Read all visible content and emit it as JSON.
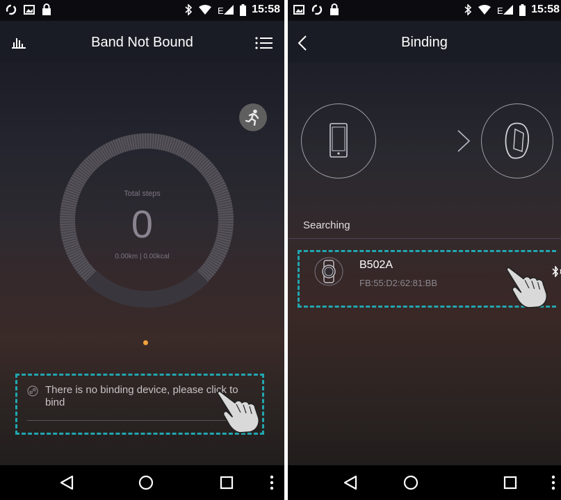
{
  "status_bar": {
    "time": "15:58"
  },
  "screen1": {
    "title": "Band Not Bound",
    "total_steps_label": "Total steps",
    "steps_value": "0",
    "distance_calories": "0.00km | 0.00kcal",
    "bind_prompt": "There is no binding device, please click to bind"
  },
  "screen2": {
    "title": "Binding",
    "searching_label": "Searching",
    "device": {
      "name": "B502A",
      "mac": "FB:55:D2:62:81:BB"
    }
  },
  "colors": {
    "highlight_dash": "#22a6b0",
    "page_dot": "#f0a23a"
  },
  "icons": [
    "chart-icon",
    "menu-icon",
    "running-icon",
    "link-icon",
    "back-icon",
    "phone-icon",
    "band-icon",
    "bluetooth-icon",
    "watch-icon",
    "pointing-hand-icon"
  ]
}
